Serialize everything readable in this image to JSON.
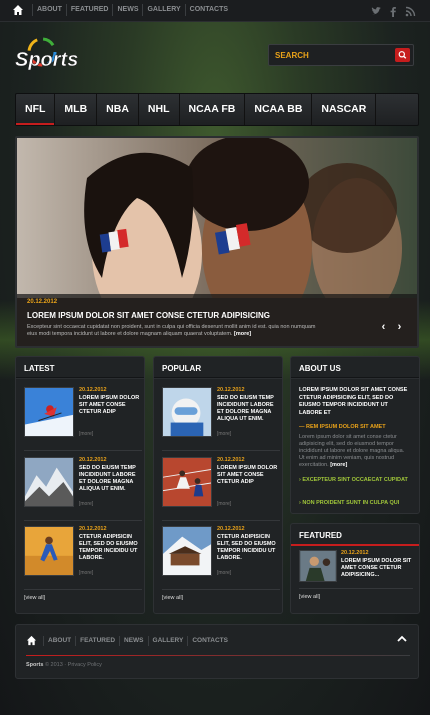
{
  "topbar": {
    "home_icon": "home-icon",
    "nav": [
      "ABOUT",
      "FEATURED",
      "NEWS",
      "GALLERY",
      "CONTACTS"
    ],
    "social_icons": [
      "twitter-icon",
      "facebook-icon",
      "rss-icon"
    ]
  },
  "header": {
    "logo_text": "Sports",
    "search_placeholder": "SEARCH",
    "search_icon": "search-icon",
    "accent": "#e9a219",
    "brand_red": "#c61d1d"
  },
  "menu": {
    "items": [
      "NFL",
      "MLB",
      "NBA",
      "NHL",
      "NCAA FB",
      "NCAA BB",
      "NASCAR"
    ],
    "active": "NFL"
  },
  "slider": {
    "date": "20.12.2012",
    "title": "LOREM IPSUM DOLOR SIT AMET CONSE CTETUR ADIPISICING",
    "text": "Excepteur sint occaecat cupidatat non proident, sunt in culpa qui officia deserunt mollit anim id est. quia non numquam eius modi tempora incidunt ut labore et dolore magnam aliquam quaerat voluptatem.",
    "more": "[more]",
    "prev_icon": "chevron-left-icon",
    "next_icon": "chevron-right-icon"
  },
  "latest": {
    "title": "LATEST",
    "items": [
      {
        "date": "20.12.2012",
        "text": "LOREM IPSUM DOLOR SIT AMET CONSE CTETUR ADIP",
        "more": "[more]"
      },
      {
        "date": "20.12.2012",
        "text": "SED DO EIUSM TEMP INCIDIDUNT LABORE ET DOLORE MAGNA ALIQUA UT ENIM.",
        "more": "[more]"
      },
      {
        "date": "20.12.2012",
        "text": "CTETUR ADIPISICIN ELIT, SED DO EIUSMO TEMPOR INCIDIDU UT LABORE.",
        "more": "[more]"
      }
    ],
    "view_all": "[view all]"
  },
  "popular": {
    "title": "POPULAR",
    "items": [
      {
        "date": "20.12.2012",
        "text": "SED DO EIUSM TEMP INCIDIDUNT LABORE ET DOLORE MAGNA ALIQUA UT ENIM.",
        "more": "[more]"
      },
      {
        "date": "20.12.2012",
        "text": "LOREM IPSUM DOLOR SIT AMET CONSE CTETUR ADIP",
        "more": "[more]"
      },
      {
        "date": "20.12.2012",
        "text": "CTETUR ADIPISICIN ELIT, SED DO EIUSMO TEMPOR INCIDIDU UT LABORE.",
        "more": "[more]"
      }
    ],
    "view_all": "[view all]"
  },
  "about": {
    "title": "ABOUT US",
    "lead": "LOREM IPSUM DOLOR SIT AMET CONSE CTETUR ADIPISICING ELIT, SED DO EIUSMO TEMPOR INCIDIDUNT UT LABORE ET",
    "link": "REM IPSUM DOLOR SIT AMET",
    "text": "Lorem ipsum dolor sit amet conse ctetur adipisicing elit, sed do eiusmod tempor incididunt ut labore et dolore magna aliqua. Ut enim ad minim veniam, quis nostrud exercitation.",
    "more": "[more]",
    "bullets": [
      "EXCEPTEUR SINT OCCAECAT CUPIDAT",
      "NON PROIDENT SUNT IN CULPA QUI"
    ]
  },
  "featured": {
    "title": "FEATURED",
    "date": "20.12.2012",
    "text": "LOREM IPSUM DOLOR SIT AMET CONSE CTETUR ADIPISICING...",
    "view_all": "[view all]"
  },
  "footer": {
    "nav": [
      "ABOUT",
      "FEATURED",
      "NEWS",
      "GALLERY",
      "CONTACTS"
    ],
    "brand": "Sports",
    "copyright": "© 2013 · Privacy Policy",
    "to_top_icon": "chevron-up-icon"
  }
}
